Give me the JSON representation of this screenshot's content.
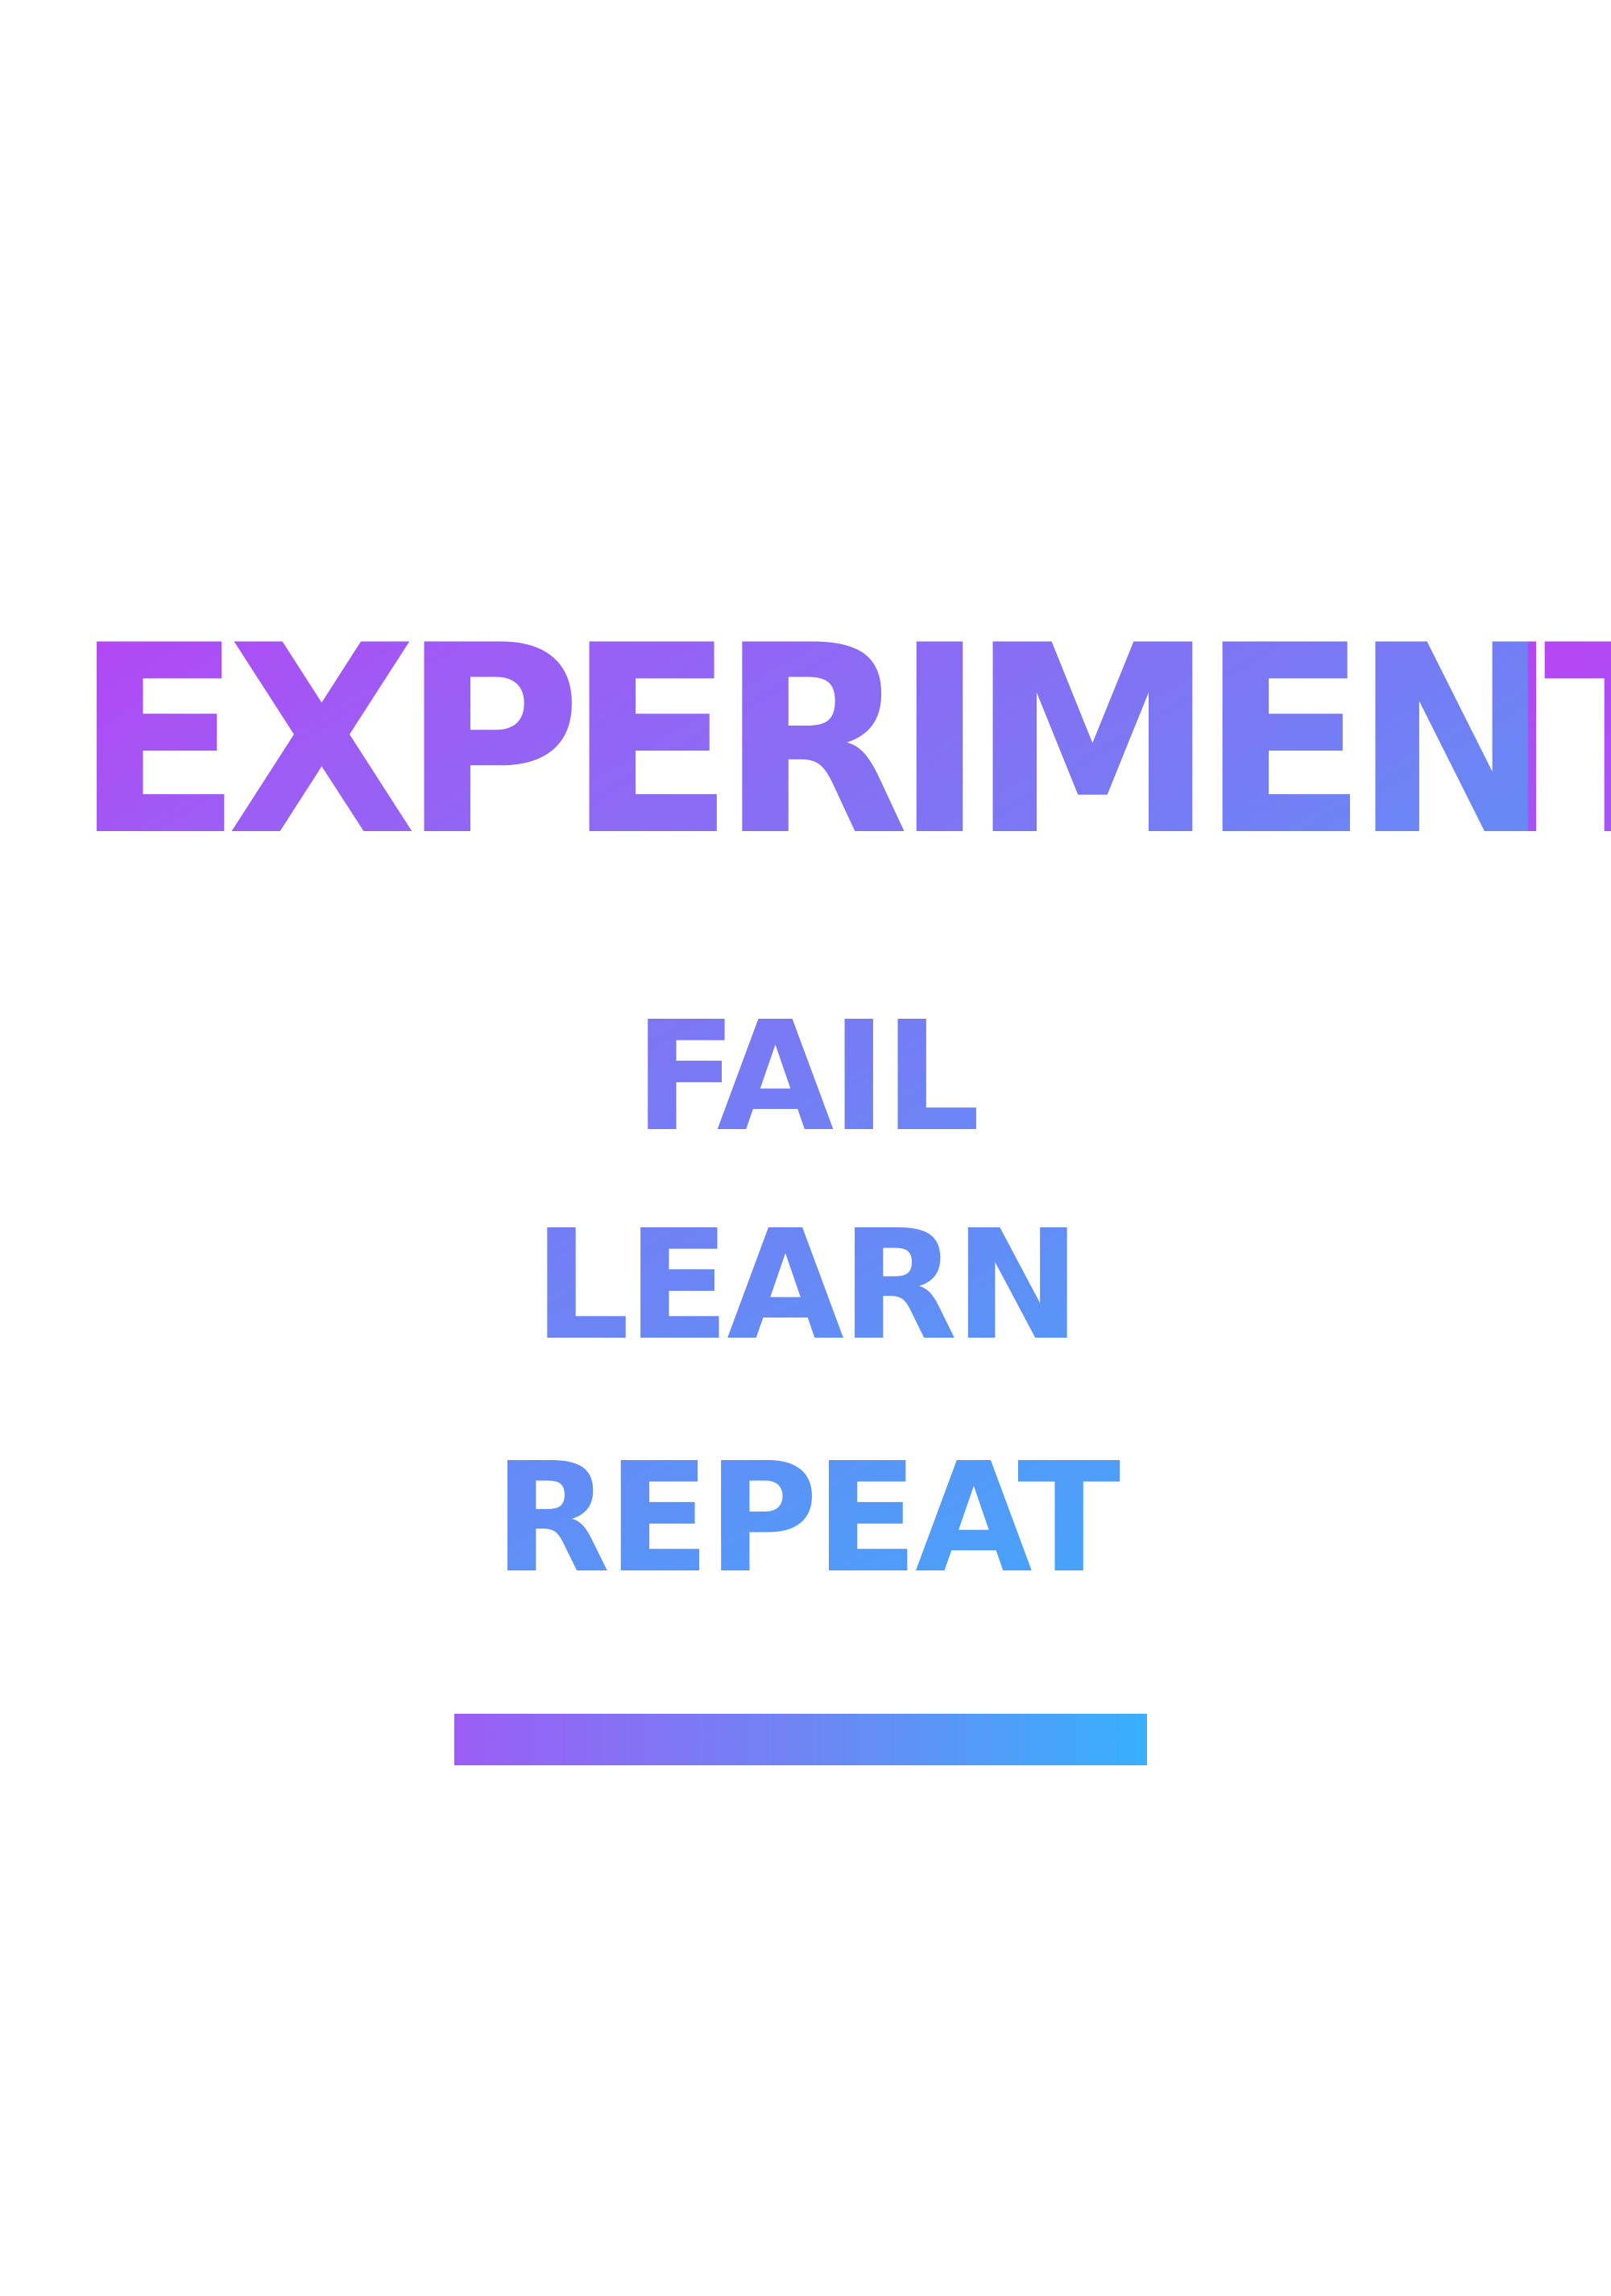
{
  "poster": {
    "headline": "EXPERIMENT",
    "words": [
      "FAIL",
      "LEARN",
      "REPEAT"
    ]
  },
  "colors": {
    "gradient_start": "#ee10ef",
    "gradient_mid": "#9b5ef5",
    "gradient_end": "#38b0fb",
    "background": "#ffffff"
  }
}
